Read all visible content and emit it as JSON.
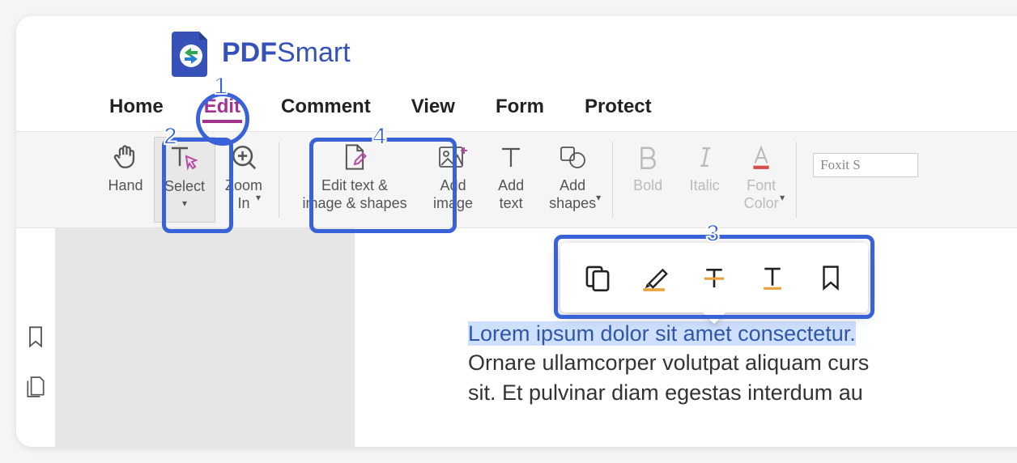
{
  "brand": {
    "bold": "PDF",
    "light": "Smart"
  },
  "menu": {
    "items": [
      "Home",
      "Edit",
      "Comment",
      "View",
      "Form",
      "Protect"
    ],
    "activeIndex": 1
  },
  "ribbon": {
    "hand": "Hand",
    "select": "Select",
    "zoomIn": "Zoom\nIn",
    "editObjects": "Edit text &\nimage & shapes",
    "addImage": "Add\nimage",
    "addText": "Add\ntext",
    "addShapes": "Add\nshapes",
    "bold": "Bold",
    "italic": "Italic",
    "fontColor": "Font\nColor",
    "fontPlaceholder": "Foxit S"
  },
  "document": {
    "selected": "Lorem ipsum dolor sit amet consectetur.",
    "line2": "Ornare ullamcorper volutpat aliquam curs",
    "line3": "sit. Et pulvinar diam egestas interdum au"
  },
  "callouts": {
    "n1": "1",
    "n2": "2",
    "n3": "3",
    "n4": "4"
  }
}
